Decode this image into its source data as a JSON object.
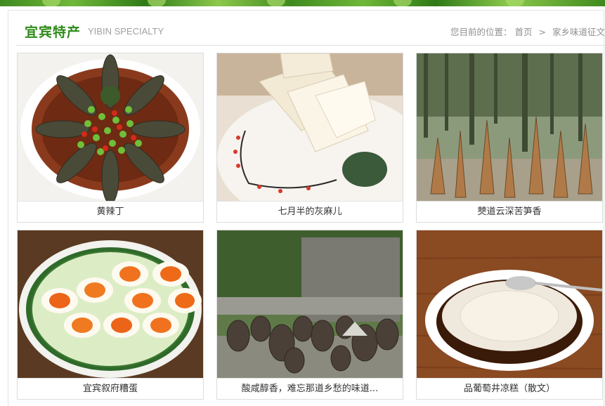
{
  "section": {
    "title": "宜宾特产",
    "title_en": "YIBIN SPECIALTY"
  },
  "breadcrumb": {
    "prefix": "您目前的位置：",
    "home": "首页",
    "separator": ">",
    "current": "家乡味道征文"
  },
  "items": [
    {
      "caption": "黄辣丁",
      "image": "fish-dish-photo"
    },
    {
      "caption": "七月半的灰麻儿",
      "image": "tofu-photo"
    },
    {
      "caption": "僰道云深苦笋香",
      "image": "bamboo-shoots-photo"
    },
    {
      "caption": "宜宾叙府糟蛋",
      "image": "salted-eggs-photo"
    },
    {
      "caption": "酸咸醇香，难忘那道乡愁的味道...",
      "image": "pickle-jars-photo"
    },
    {
      "caption": "品葡萄井凉糕（散文）",
      "image": "jelly-cake-photo"
    }
  ]
}
